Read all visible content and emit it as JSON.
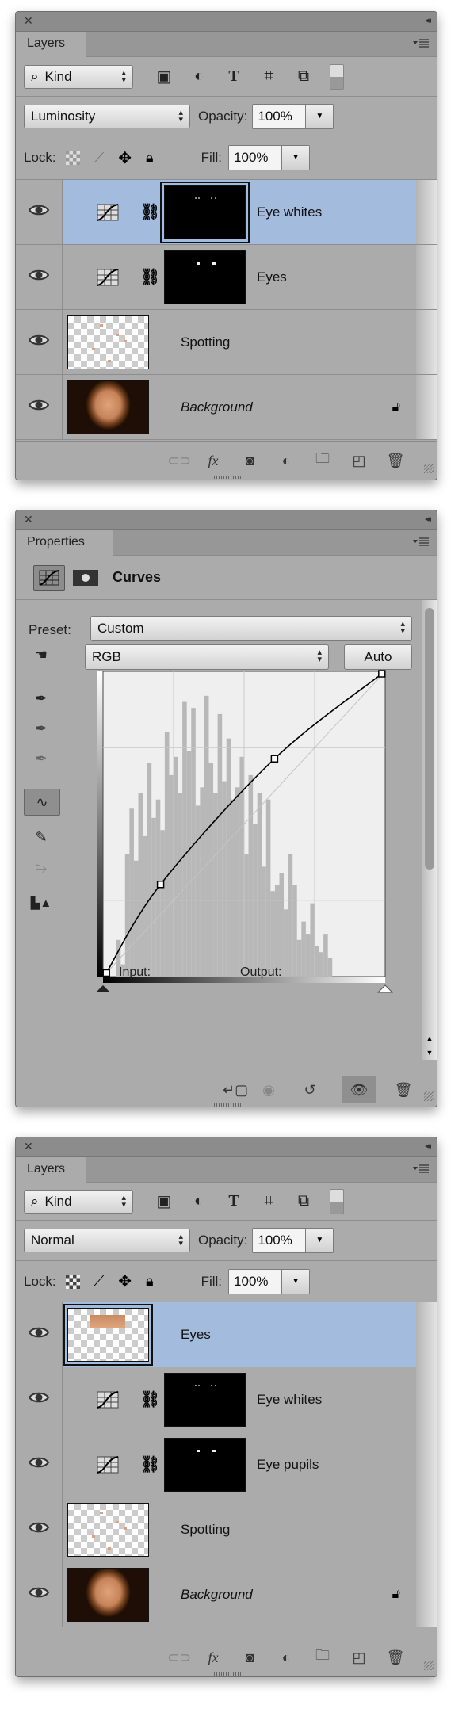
{
  "panels": {
    "layers_top": {
      "tab": "Layers",
      "filter_kind": "Kind",
      "blend_mode": "Luminosity",
      "opacity_label": "Opacity:",
      "opacity": "100%",
      "lock_label": "Lock:",
      "fill_label": "Fill:",
      "fill": "100%",
      "layers": [
        {
          "name": "Eye whites",
          "type": "curves",
          "selected": true,
          "mask": "whites"
        },
        {
          "name": "Eyes",
          "type": "curves",
          "selected": false,
          "mask": "pupils"
        },
        {
          "name": "Spotting",
          "type": "pixel",
          "selected": false,
          "thumb": "checker"
        },
        {
          "name": "Background",
          "type": "pixel",
          "selected": false,
          "thumb": "face",
          "italic": true,
          "locked": true
        }
      ]
    },
    "properties": {
      "tab": "Properties",
      "title": "Curves",
      "preset_label": "Preset:",
      "preset": "Custom",
      "channel": "RGB",
      "auto_label": "Auto",
      "input_label": "Input:",
      "output_label": "Output:"
    },
    "layers_bottom": {
      "tab": "Layers",
      "filter_kind": "Kind",
      "blend_mode": "Normal",
      "opacity_label": "Opacity:",
      "opacity": "100%",
      "lock_label": "Lock:",
      "fill_label": "Fill:",
      "fill": "100%",
      "layers": [
        {
          "name": "Eyes",
          "type": "pixel",
          "selected": true,
          "thumb": "eyes"
        },
        {
          "name": "Eye whites",
          "type": "curves",
          "selected": false,
          "mask": "whites"
        },
        {
          "name": "Eye pupils",
          "type": "curves",
          "selected": false,
          "mask": "pupils"
        },
        {
          "name": "Spotting",
          "type": "pixel",
          "selected": false,
          "thumb": "checker"
        },
        {
          "name": "Background",
          "type": "pixel",
          "selected": false,
          "thumb": "face",
          "italic": true,
          "locked": true
        }
      ]
    }
  },
  "curve": {
    "points": [
      [
        3,
        3
      ],
      [
        52,
        77
      ],
      [
        155,
        182
      ],
      [
        252,
        253
      ]
    ],
    "range": [
      0,
      255
    ],
    "grid_divisions": 4,
    "histogram": [
      0,
      0,
      0,
      12,
      4,
      40,
      55,
      38,
      60,
      46,
      70,
      52,
      58,
      48,
      80,
      66,
      72,
      60,
      90,
      74,
      88,
      56,
      62,
      92,
      70,
      60,
      86,
      64,
      78,
      58,
      62,
      72,
      40,
      66,
      50,
      60,
      36,
      58,
      28,
      30,
      34,
      22,
      40,
      30,
      12,
      18,
      14,
      24,
      10,
      8,
      14,
      6,
      0,
      0,
      0,
      0,
      0,
      0,
      0,
      0,
      0,
      0,
      0,
      0
    ]
  },
  "colors": {
    "panel": "#ababab",
    "selected_row": "#a3bbdd",
    "titlebar": "#8c8c8c"
  }
}
